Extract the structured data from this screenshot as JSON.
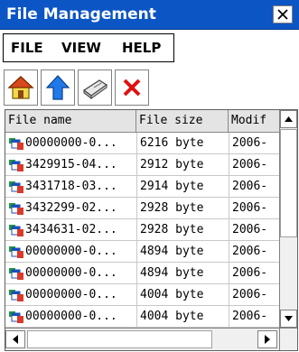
{
  "window": {
    "title": "File Management",
    "title_bar_color": "#0b55c4"
  },
  "menu": {
    "items": [
      {
        "label": "FILE"
      },
      {
        "label": "VIEW"
      },
      {
        "label": "HELP"
      }
    ]
  },
  "toolbar": {
    "buttons": [
      {
        "icon": "home-icon"
      },
      {
        "icon": "up-arrow-icon"
      },
      {
        "icon": "storage-card-icon"
      },
      {
        "icon": "delete-x-icon"
      }
    ]
  },
  "file_list": {
    "columns": [
      "File name",
      "File size",
      "Modif"
    ],
    "rows": [
      {
        "name": "00000000-0...",
        "size": "6216 byte",
        "modified": "2006-"
      },
      {
        "name": "3429915-04...",
        "size": "2912 byte",
        "modified": "2006-"
      },
      {
        "name": "3431718-03...",
        "size": "2914 byte",
        "modified": "2006-"
      },
      {
        "name": "3432299-02...",
        "size": "2928 byte",
        "modified": "2006-"
      },
      {
        "name": "3434631-02...",
        "size": "2928 byte",
        "modified": "2006-"
      },
      {
        "name": "00000000-0...",
        "size": "4894 byte",
        "modified": "2006-"
      },
      {
        "name": "00000000-0...",
        "size": "4894 byte",
        "modified": "2006-"
      },
      {
        "name": "00000000-0...",
        "size": "4004 byte",
        "modified": "2006-"
      },
      {
        "name": "00000000-0...",
        "size": "4004 byte",
        "modified": "2006-"
      }
    ]
  }
}
